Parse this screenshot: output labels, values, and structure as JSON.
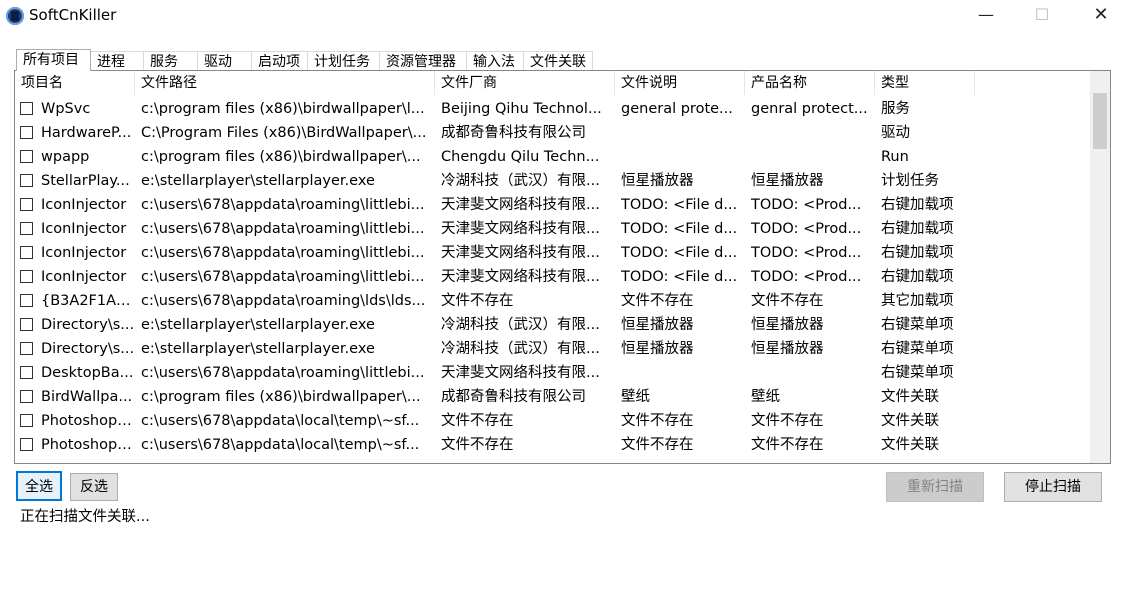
{
  "window": {
    "title": "SoftCnKiller",
    "minimize_glyph": "—",
    "maximize_glyph": "☐",
    "close_glyph": "✕"
  },
  "tabs": [
    {
      "label": "所有项目",
      "active": true
    },
    {
      "label": "进程"
    },
    {
      "label": "服务"
    },
    {
      "label": "驱动"
    },
    {
      "label": "启动项"
    },
    {
      "label": "计划任务"
    },
    {
      "label": "资源管理器"
    },
    {
      "label": "输入法"
    },
    {
      "label": "文件关联"
    }
  ],
  "table": {
    "columns": [
      "项目名",
      "文件路径",
      "文件厂商",
      "文件说明",
      "产品名称",
      "类型"
    ],
    "rows": [
      [
        "WpSvc",
        "c:\\program files (x86)\\birdwallpaper\\l...",
        "Beijing Qihu Technol...",
        "general prote...",
        "genral protect...",
        "服务"
      ],
      [
        "HardwareP...",
        "C:\\Program Files (x86)\\BirdWallpaper\\...",
        "成都奇鲁科技有限公司",
        "",
        "",
        "驱动"
      ],
      [
        "wpapp",
        "c:\\program files (x86)\\birdwallpaper\\...",
        "Chengdu Qilu Techn...",
        "",
        "",
        "Run"
      ],
      [
        "StellarPlay...",
        "e:\\stellarplayer\\stellarplayer.exe",
        "冷湖科技（武汉）有限...",
        "恒星播放器",
        "恒星播放器",
        "计划任务"
      ],
      [
        "IconInjector",
        "c:\\users\\678\\appdata\\roaming\\littlebi...",
        "天津斐文网络科技有限...",
        "TODO: <File d...",
        "TODO: <Prod...",
        "右键加载项"
      ],
      [
        "IconInjector",
        "c:\\users\\678\\appdata\\roaming\\littlebi...",
        "天津斐文网络科技有限...",
        "TODO: <File d...",
        "TODO: <Prod...",
        "右键加载项"
      ],
      [
        "IconInjector",
        "c:\\users\\678\\appdata\\roaming\\littlebi...",
        "天津斐文网络科技有限...",
        "TODO: <File d...",
        "TODO: <Prod...",
        "右键加载项"
      ],
      [
        "IconInjector",
        "c:\\users\\678\\appdata\\roaming\\littlebi...",
        "天津斐文网络科技有限...",
        "TODO: <File d...",
        "TODO: <Prod...",
        "右键加载项"
      ],
      [
        "{B3A2F1A4...",
        "c:\\users\\678\\appdata\\roaming\\lds\\lds...",
        "文件不存在",
        "文件不存在",
        "文件不存在",
        "其它加载项"
      ],
      [
        "Directory\\s...",
        "e:\\stellarplayer\\stellarplayer.exe",
        "冷湖科技（武汉）有限...",
        "恒星播放器",
        "恒星播放器",
        "右键菜单项"
      ],
      [
        "Directory\\s...",
        "e:\\stellarplayer\\stellarplayer.exe",
        "冷湖科技（武汉）有限...",
        "恒星播放器",
        "恒星播放器",
        "右键菜单项"
      ],
      [
        "DesktopBa...",
        "c:\\users\\678\\appdata\\roaming\\littlebi...",
        "天津斐文网络科技有限...",
        "",
        "",
        "右键菜单项"
      ],
      [
        "BirdWallpa...",
        "c:\\program files (x86)\\birdwallpaper\\...",
        "成都奇鲁科技有限公司",
        "壁纸",
        "壁纸",
        "文件关联"
      ],
      [
        "Photoshop....",
        "c:\\users\\678\\appdata\\local\\temp\\~sf...",
        "文件不存在",
        "文件不存在",
        "文件不存在",
        "文件关联"
      ],
      [
        "Photoshop....",
        "c:\\users\\678\\appdata\\local\\temp\\~sf...",
        "文件不存在",
        "文件不存在",
        "文件不存在",
        "文件关联"
      ]
    ]
  },
  "buttons": {
    "select_all": "全选",
    "invert": "反选",
    "rescan": "重新扫描",
    "stop_scan": "停止扫描"
  },
  "status": "正在扫描文件关联..."
}
